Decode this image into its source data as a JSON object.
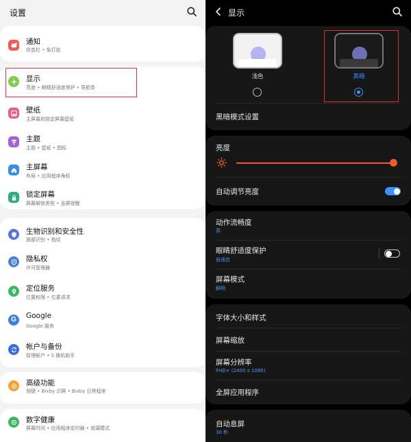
{
  "left": {
    "title": "设置",
    "items": [
      {
        "title": "通知",
        "sub": "状态栏 • 免打扰",
        "icon": "bell-icon",
        "color": "#ef5a57"
      },
      {
        "title": "显示",
        "sub": "亮度 • 眼睛舒适度保护 • 导航条",
        "icon": "sun-icon",
        "color": "#7ccb4a"
      },
      {
        "title": "壁纸",
        "sub": "主屏幕和锁定屏幕壁纸",
        "icon": "wallpaper-icon",
        "color": "#e95b8c"
      },
      {
        "title": "主题",
        "sub": "主题 • 壁纸 • 图标",
        "icon": "theme-brush-icon",
        "color": "#a462d6"
      },
      {
        "title": "主屏幕",
        "sub": "布局 • 应用程序角标",
        "icon": "home-icon",
        "color": "#3b8de0"
      },
      {
        "title": "锁定屏幕",
        "sub": "屏幕解锁类型 • 息屏提醒",
        "icon": "lock-icon",
        "color": "#2fae7d"
      },
      {
        "title": "生物识别和安全性",
        "sub": "面部识别 • 指纹",
        "icon": "shield-icon",
        "color": "#5a73dd"
      },
      {
        "title": "隐私权",
        "sub": "许可管理器",
        "icon": "privacy-shield-icon",
        "color": "#4d7fd6"
      },
      {
        "title": "定位服务",
        "sub": "位置权限 • 位置请求",
        "icon": "location-pin-icon",
        "color": "#3fb866"
      },
      {
        "title": "Google",
        "sub": "Google 服务",
        "icon": "google-icon",
        "color": "#3d7de4"
      },
      {
        "title": "帐户与备份",
        "sub": "管理帐户 • S 换机助手",
        "icon": "sync-icon",
        "color": "#3b6fd8"
      },
      {
        "title": "高级功能",
        "sub": "侧键 • Bixby 识屏 • Bixby 日常程序",
        "icon": "gear-plus-icon",
        "color": "#f0a33a"
      },
      {
        "title": "数字健康",
        "sub": "屏幕时间 • 应用程序定时器 • 就寝模式",
        "icon": "wellbeing-icon",
        "color": "#3fb45f"
      }
    ]
  },
  "right": {
    "title": "显示",
    "theme": {
      "light_label": "浅色",
      "dark_label": "黑暗",
      "selected": "dark"
    },
    "dark_mode_settings": "黑暗模式设置",
    "brightness_label": "亮度",
    "brightness_level": 1.0,
    "adaptive_brightness": {
      "label": "自动调节亮度",
      "on": true
    },
    "motion_smoothness": {
      "label": "动作流畅度",
      "sub": "高"
    },
    "eye_comfort": {
      "label": "眼睛舒适度保护",
      "sub": "自适应",
      "on": false
    },
    "screen_mode": {
      "label": "屏幕模式",
      "sub": "鲜明"
    },
    "font_size": "字体大小和样式",
    "screen_zoom": "屏幕缩放",
    "resolution": {
      "label": "屏幕分辨率",
      "sub": "FHD+ (2400 x 1080)"
    },
    "full_screen_apps": "全屏应用程序",
    "screen_timeout": {
      "label": "自动息屏",
      "sub": "30 秒"
    }
  },
  "colors": {
    "accent_blue": "#3e91ff",
    "brightness_orange": "#ee5c2c",
    "highlight_red": "#d8333b"
  }
}
